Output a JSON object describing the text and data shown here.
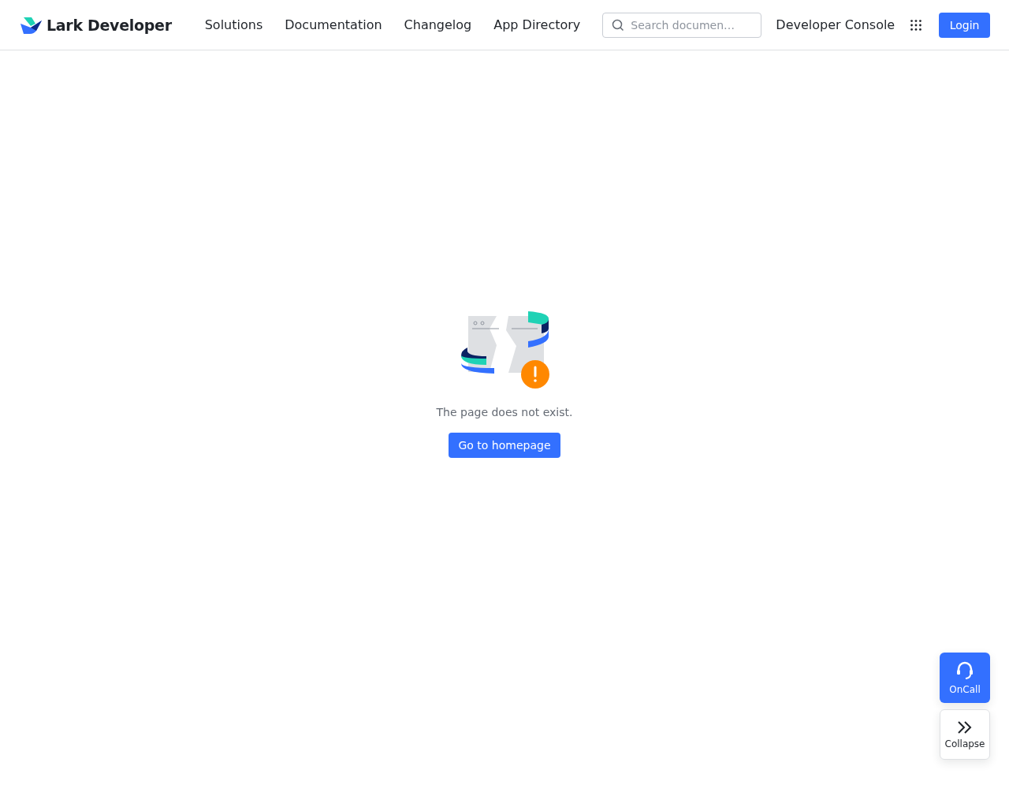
{
  "header": {
    "logo": "Lark Developer",
    "nav": [
      "Solutions",
      "Documentation",
      "Changelog",
      "App Directory"
    ],
    "search": {
      "placeholder": "Search documen…"
    },
    "console_link": "Developer Console",
    "login_button": "Login"
  },
  "error": {
    "message": "The page does not exist.",
    "button": "Go to homepage"
  },
  "float_buttons": [
    {
      "kind": "oncall",
      "label": "OnCall"
    },
    {
      "kind": "collapse",
      "label": "Collapse"
    }
  ]
}
